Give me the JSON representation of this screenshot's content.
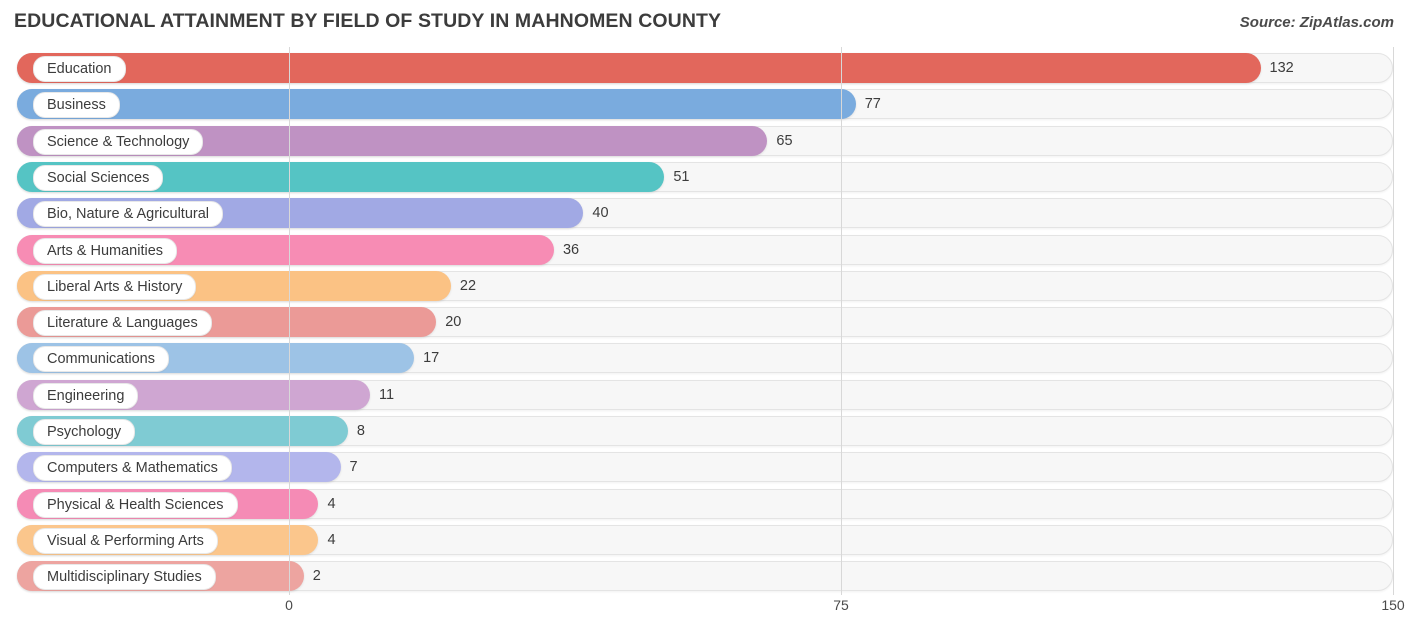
{
  "header": {
    "title": "EDUCATIONAL ATTAINMENT BY FIELD OF STUDY IN MAHNOMEN COUNTY",
    "source": "Source: ZipAtlas.com"
  },
  "chart_data": {
    "type": "bar",
    "orientation": "horizontal",
    "title": "EDUCATIONAL ATTAINMENT BY FIELD OF STUDY IN MAHNOMEN COUNTY",
    "source": "Source: ZipAtlas.com",
    "xlabel": "",
    "ylabel": "",
    "xlim": [
      0,
      150
    ],
    "ticks": [
      "0",
      "75",
      "150"
    ],
    "tick_values": [
      0,
      75,
      150
    ],
    "grid": true,
    "legend": "none",
    "categories": [
      "Education",
      "Business",
      "Science & Technology",
      "Social Sciences",
      "Bio, Nature & Agricultural",
      "Arts & Humanities",
      "Liberal Arts & History",
      "Literature & Languages",
      "Communications",
      "Engineering",
      "Psychology",
      "Computers & Mathematics",
      "Physical & Health Sciences",
      "Visual & Performing Arts",
      "Multidisciplinary Studies"
    ],
    "values": [
      132,
      77,
      65,
      51,
      40,
      36,
      22,
      20,
      17,
      11,
      8,
      7,
      4,
      4,
      2
    ],
    "value_labels": [
      "132",
      "77",
      "65",
      "51",
      "40",
      "36",
      "22",
      "20",
      "17",
      "11",
      "8",
      "7",
      "4",
      "4",
      "2"
    ],
    "colors": [
      "#e2675c",
      "#7aabde",
      "#bf92c3",
      "#55c4c4",
      "#a1a9e4",
      "#f78cb4",
      "#fbc284",
      "#eb9a97",
      "#9dc3e6",
      "#cfa6d2",
      "#7fcbd3",
      "#b3b6ec",
      "#f58bb5",
      "#fbc68c",
      "#eda4a0"
    ]
  }
}
